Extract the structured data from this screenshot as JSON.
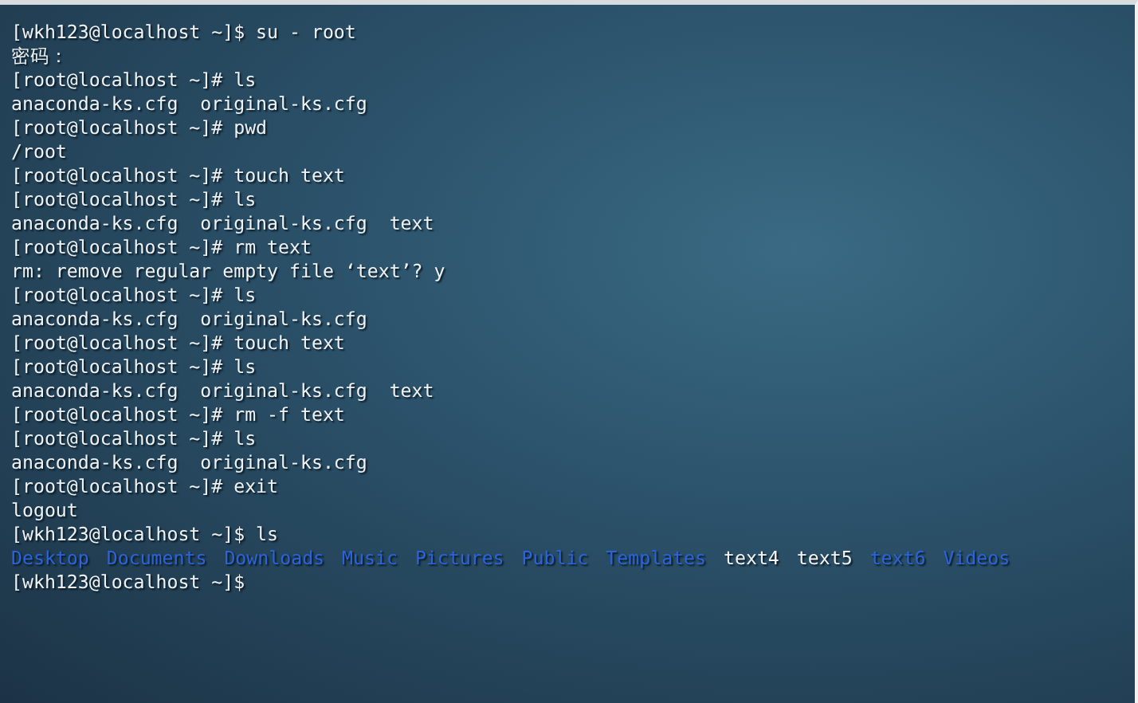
{
  "terminal": {
    "lines": [
      {
        "kind": "text",
        "text": "[wkh123@localhost ~]$ su - root"
      },
      {
        "kind": "text",
        "text": "密码："
      },
      {
        "kind": "text",
        "text": "[root@localhost ~]# ls"
      },
      {
        "kind": "text",
        "text": "anaconda-ks.cfg  original-ks.cfg"
      },
      {
        "kind": "text",
        "text": "[root@localhost ~]# pwd"
      },
      {
        "kind": "text",
        "text": "/root"
      },
      {
        "kind": "text",
        "text": "[root@localhost ~]# touch text"
      },
      {
        "kind": "text",
        "text": "[root@localhost ~]# ls"
      },
      {
        "kind": "text",
        "text": "anaconda-ks.cfg  original-ks.cfg  text"
      },
      {
        "kind": "text",
        "text": "[root@localhost ~]# rm text"
      },
      {
        "kind": "text",
        "text": "rm: remove regular empty file ‘text’? y"
      },
      {
        "kind": "text",
        "text": "[root@localhost ~]# ls"
      },
      {
        "kind": "text",
        "text": "anaconda-ks.cfg  original-ks.cfg"
      },
      {
        "kind": "text",
        "text": "[root@localhost ~]# touch text"
      },
      {
        "kind": "text",
        "text": "[root@localhost ~]# ls"
      },
      {
        "kind": "text",
        "text": "anaconda-ks.cfg  original-ks.cfg  text"
      },
      {
        "kind": "text",
        "text": "[root@localhost ~]# rm -f text"
      },
      {
        "kind": "text",
        "text": "[root@localhost ~]# ls"
      },
      {
        "kind": "text",
        "text": "anaconda-ks.cfg  original-ks.cfg"
      },
      {
        "kind": "text",
        "text": "[root@localhost ~]# exit"
      },
      {
        "kind": "text",
        "text": "logout"
      },
      {
        "kind": "text",
        "text": "[wkh123@localhost ~]$ ls"
      },
      {
        "kind": "listing",
        "entries": [
          {
            "name": "Desktop",
            "kind": "dir"
          },
          {
            "name": "Documents",
            "kind": "dir"
          },
          {
            "name": "Downloads",
            "kind": "dir"
          },
          {
            "name": "Music",
            "kind": "dir"
          },
          {
            "name": "Pictures",
            "kind": "dir"
          },
          {
            "name": "Public",
            "kind": "dir"
          },
          {
            "name": "Templates",
            "kind": "dir"
          },
          {
            "name": "text4",
            "kind": "file"
          },
          {
            "name": "text5",
            "kind": "file"
          },
          {
            "name": "text6",
            "kind": "dir"
          },
          {
            "name": "Videos",
            "kind": "dir"
          }
        ]
      },
      {
        "kind": "text",
        "text": "[wkh123@localhost ~]$"
      }
    ]
  }
}
